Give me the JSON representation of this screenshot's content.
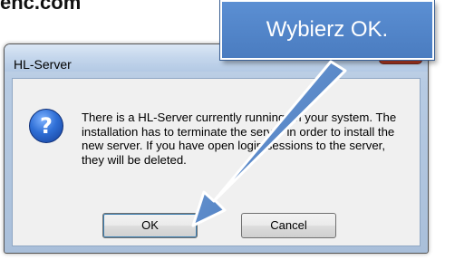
{
  "background": {
    "site_text": "ehc.com"
  },
  "dialog": {
    "title": "HL-Server",
    "icon": "question-icon",
    "icon_glyph": "?",
    "message": "There is a HL-Server currently running on your system. The installation has to terminate the server in order to install the new server. If you have open login sessions to the server, they will be deleted.",
    "buttons": {
      "ok_label": "OK",
      "cancel_label": "Cancel"
    }
  },
  "callout": {
    "text": "Wybierz OK.",
    "color": "#4f83c7"
  }
}
